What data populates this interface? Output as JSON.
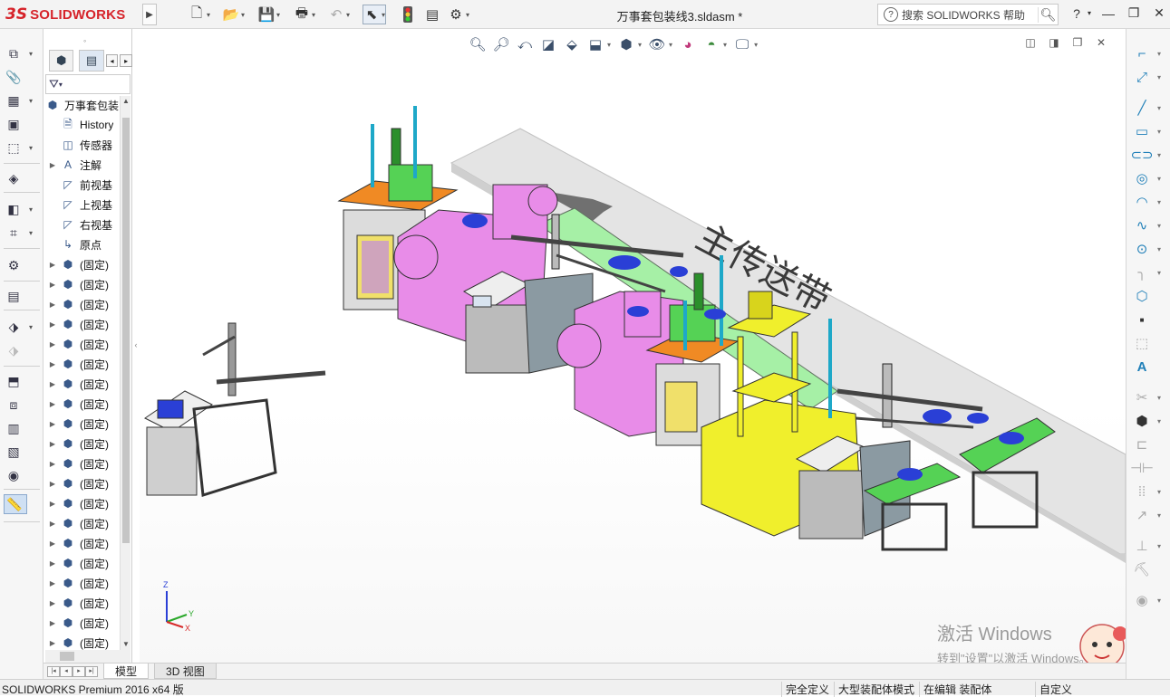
{
  "app": {
    "logo_mark": "3S",
    "logo_text": "SOLIDWORKS",
    "doc_title": "万事套包装线3.sldasm *"
  },
  "search": {
    "placeholder": "搜索 SOLIDWORKS 帮助"
  },
  "quick_access": [
    {
      "name": "new-icon",
      "glyph": "🗋"
    },
    {
      "name": "open-icon",
      "glyph": "📂"
    },
    {
      "name": "save-icon",
      "glyph": "💾"
    },
    {
      "name": "print-icon",
      "glyph": "🖶"
    },
    {
      "name": "undo-icon",
      "glyph": "↶"
    },
    {
      "name": "select-icon",
      "glyph": "⬉"
    },
    {
      "name": "rebuild-icon",
      "glyph": "🚦"
    },
    {
      "name": "file-properties-icon",
      "glyph": "▤"
    },
    {
      "name": "options-icon",
      "glyph": "⚙"
    }
  ],
  "window_buttons": {
    "help": "?",
    "minimize": "—",
    "restore": "❐",
    "close": "✕"
  },
  "feature_tree": {
    "root": "万事套包装",
    "items": [
      {
        "label": "History",
        "icon": "history-icon",
        "expandable": false
      },
      {
        "label": "传感器",
        "icon": "sensor-icon",
        "expandable": false
      },
      {
        "label": "注解",
        "icon": "annotation-icon",
        "expandable": true
      },
      {
        "label": "前视基",
        "icon": "plane-icon",
        "expandable": false
      },
      {
        "label": "上视基",
        "icon": "plane-icon",
        "expandable": false
      },
      {
        "label": "右视基",
        "icon": "plane-icon",
        "expandable": false
      },
      {
        "label": "原点",
        "icon": "origin-icon",
        "expandable": false
      },
      {
        "label": "(固定)",
        "icon": "part-icon",
        "expandable": true
      },
      {
        "label": "(固定)",
        "icon": "part-icon",
        "expandable": true
      },
      {
        "label": "(固定)",
        "icon": "part-icon",
        "expandable": true
      },
      {
        "label": "(固定)",
        "icon": "part-icon",
        "expandable": true
      },
      {
        "label": "(固定)",
        "icon": "part-icon",
        "expandable": true
      },
      {
        "label": "(固定)",
        "icon": "part-icon",
        "expandable": true
      },
      {
        "label": "(固定)",
        "icon": "part-icon",
        "expandable": true
      },
      {
        "label": "(固定)",
        "icon": "part-icon",
        "expandable": true
      },
      {
        "label": "(固定)",
        "icon": "part-icon",
        "expandable": true
      },
      {
        "label": "(固定)",
        "icon": "part-icon",
        "expandable": true
      },
      {
        "label": "(固定)",
        "icon": "part-icon",
        "expandable": true
      },
      {
        "label": "(固定)",
        "icon": "part-icon",
        "expandable": true
      },
      {
        "label": "(固定)",
        "icon": "part-icon",
        "expandable": true
      },
      {
        "label": "(固定)",
        "icon": "part-icon",
        "expandable": true
      },
      {
        "label": "(固定)",
        "icon": "part-icon",
        "expandable": true
      },
      {
        "label": "(固定)",
        "icon": "part-icon",
        "expandable": true
      },
      {
        "label": "(固定)",
        "icon": "part-icon",
        "expandable": true
      },
      {
        "label": "(固定)",
        "icon": "part-icon",
        "expandable": true
      },
      {
        "label": "(固定)",
        "icon": "part-icon",
        "expandable": true
      },
      {
        "label": "(固定)",
        "icon": "part-icon",
        "expandable": true
      },
      {
        "label": "(固定)",
        "icon": "part-icon",
        "expandable": true
      },
      {
        "label": "(固定)",
        "icon": "part-icon",
        "expandable": true
      }
    ]
  },
  "scene": {
    "conveyor_label": "主传送带"
  },
  "triad": {
    "x": "X",
    "y": "Y",
    "z": "Z"
  },
  "watermark": {
    "line1": "激活 Windows",
    "line2": "转到\"设置\"以激活 Windows。"
  },
  "tabs": [
    {
      "label": "模型",
      "active": true
    },
    {
      "label": "3D 视图",
      "active": false
    }
  ],
  "status": {
    "app": "SOLIDWORKS Premium 2016 x64 版",
    "fully_defined": "完全定义",
    "large_assembly": "大型装配体模式",
    "editing": "在编辑 装配体",
    "custom": "自定义"
  },
  "colors": {
    "brand": "#d6232a",
    "conveyor": "#e3e3e3",
    "magenta": "#e88ce8",
    "yellow": "#f0ef2c",
    "green": "#55d255",
    "orange": "#f08a24",
    "blue": "#2a3fd6"
  }
}
